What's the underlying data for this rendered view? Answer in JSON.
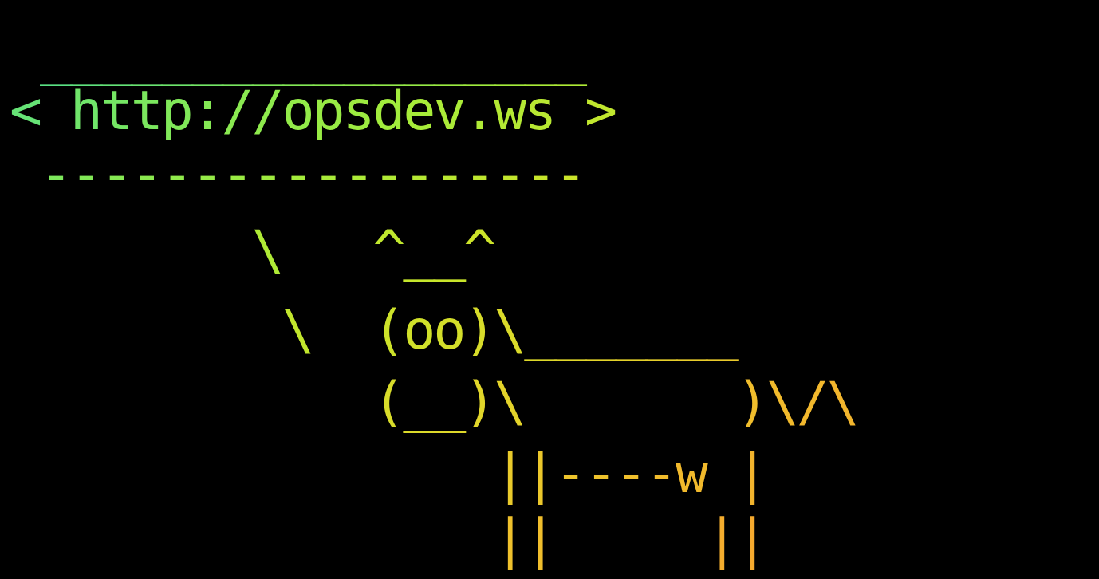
{
  "terminal": {
    "background": "#000000",
    "lines": [
      " __________________",
      "< http://opsdev.ws >",
      " ------------------",
      "        \\   ^__^",
      "         \\  (oo)\\_______",
      "            (__)\\       )\\/\\",
      "                ||----w |",
      "                ||     ||"
    ],
    "palette": [
      "#55e08a",
      "#7ee85a",
      "#a6ec3a",
      "#c9e52a",
      "#e2d52a",
      "#f0bf2c",
      "#f5a82e"
    ]
  }
}
